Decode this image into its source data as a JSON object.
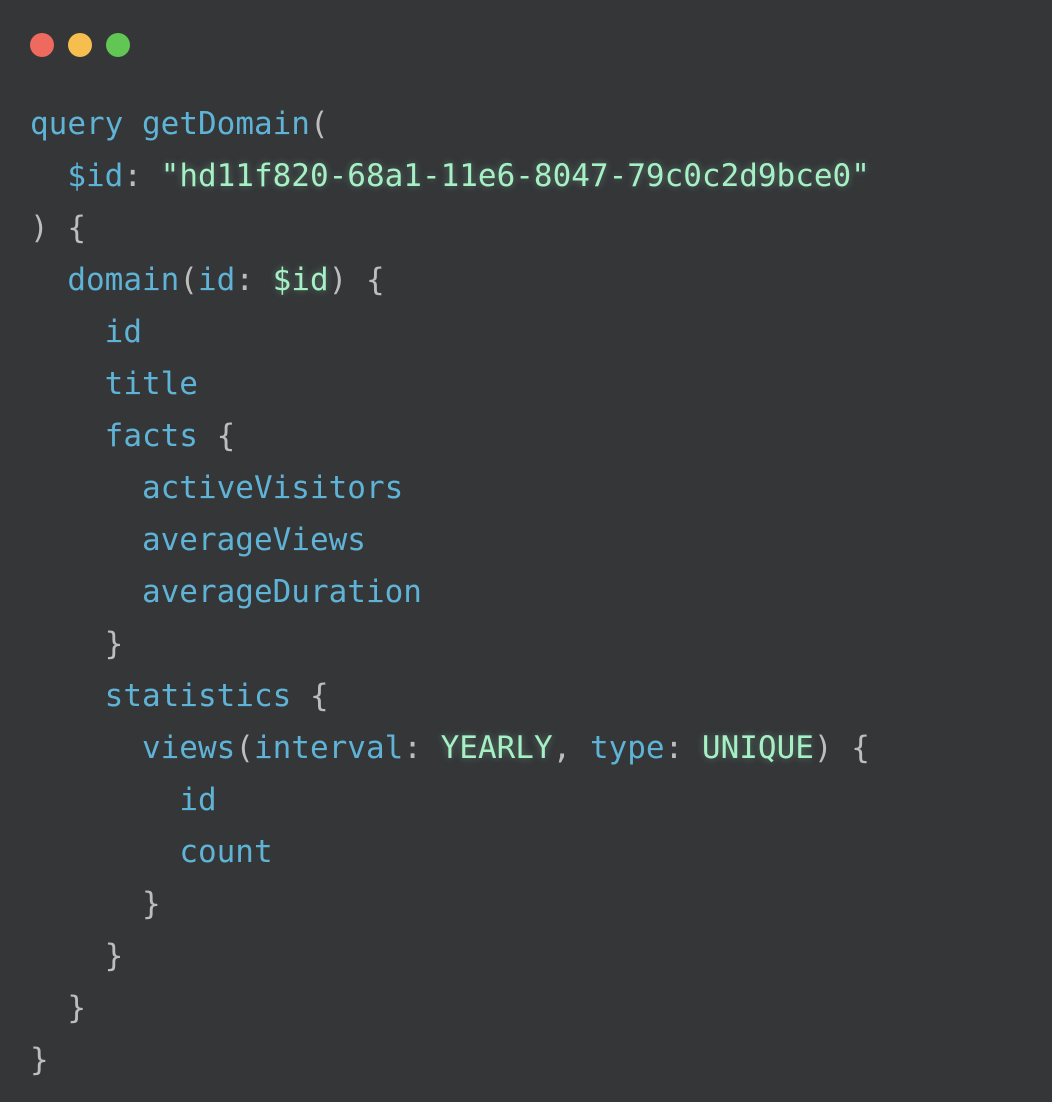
{
  "window": {
    "controls": [
      {
        "name": "close",
        "color": "#ee6a5f"
      },
      {
        "name": "minimize",
        "color": "#f5be4f"
      },
      {
        "name": "maximize",
        "color": "#62c655"
      }
    ]
  },
  "colors": {
    "background": "#343638",
    "keyword": "#5fb3d6",
    "string": "#a6f0c6",
    "punctuation": "#bdbdbd"
  },
  "code": {
    "query_keyword": "query",
    "operation_name": "getDomain",
    "variable_name": "$id",
    "variable_value": "\"hd11f820-68a1-11e6-8047-79c0c2d9bce0\"",
    "root_field": "domain",
    "root_arg_name": "id",
    "root_arg_value": "$id",
    "field_id": "id",
    "field_title": "title",
    "field_facts": "facts",
    "facts_fields": [
      "activeVisitors",
      "averageViews",
      "averageDuration"
    ],
    "field_statistics": "statistics",
    "field_views": "views",
    "views_arg1_name": "interval",
    "views_arg1_value": "YEARLY",
    "views_arg2_name": "type",
    "views_arg2_value": "UNIQUE",
    "views_fields": [
      "id",
      "count"
    ]
  }
}
